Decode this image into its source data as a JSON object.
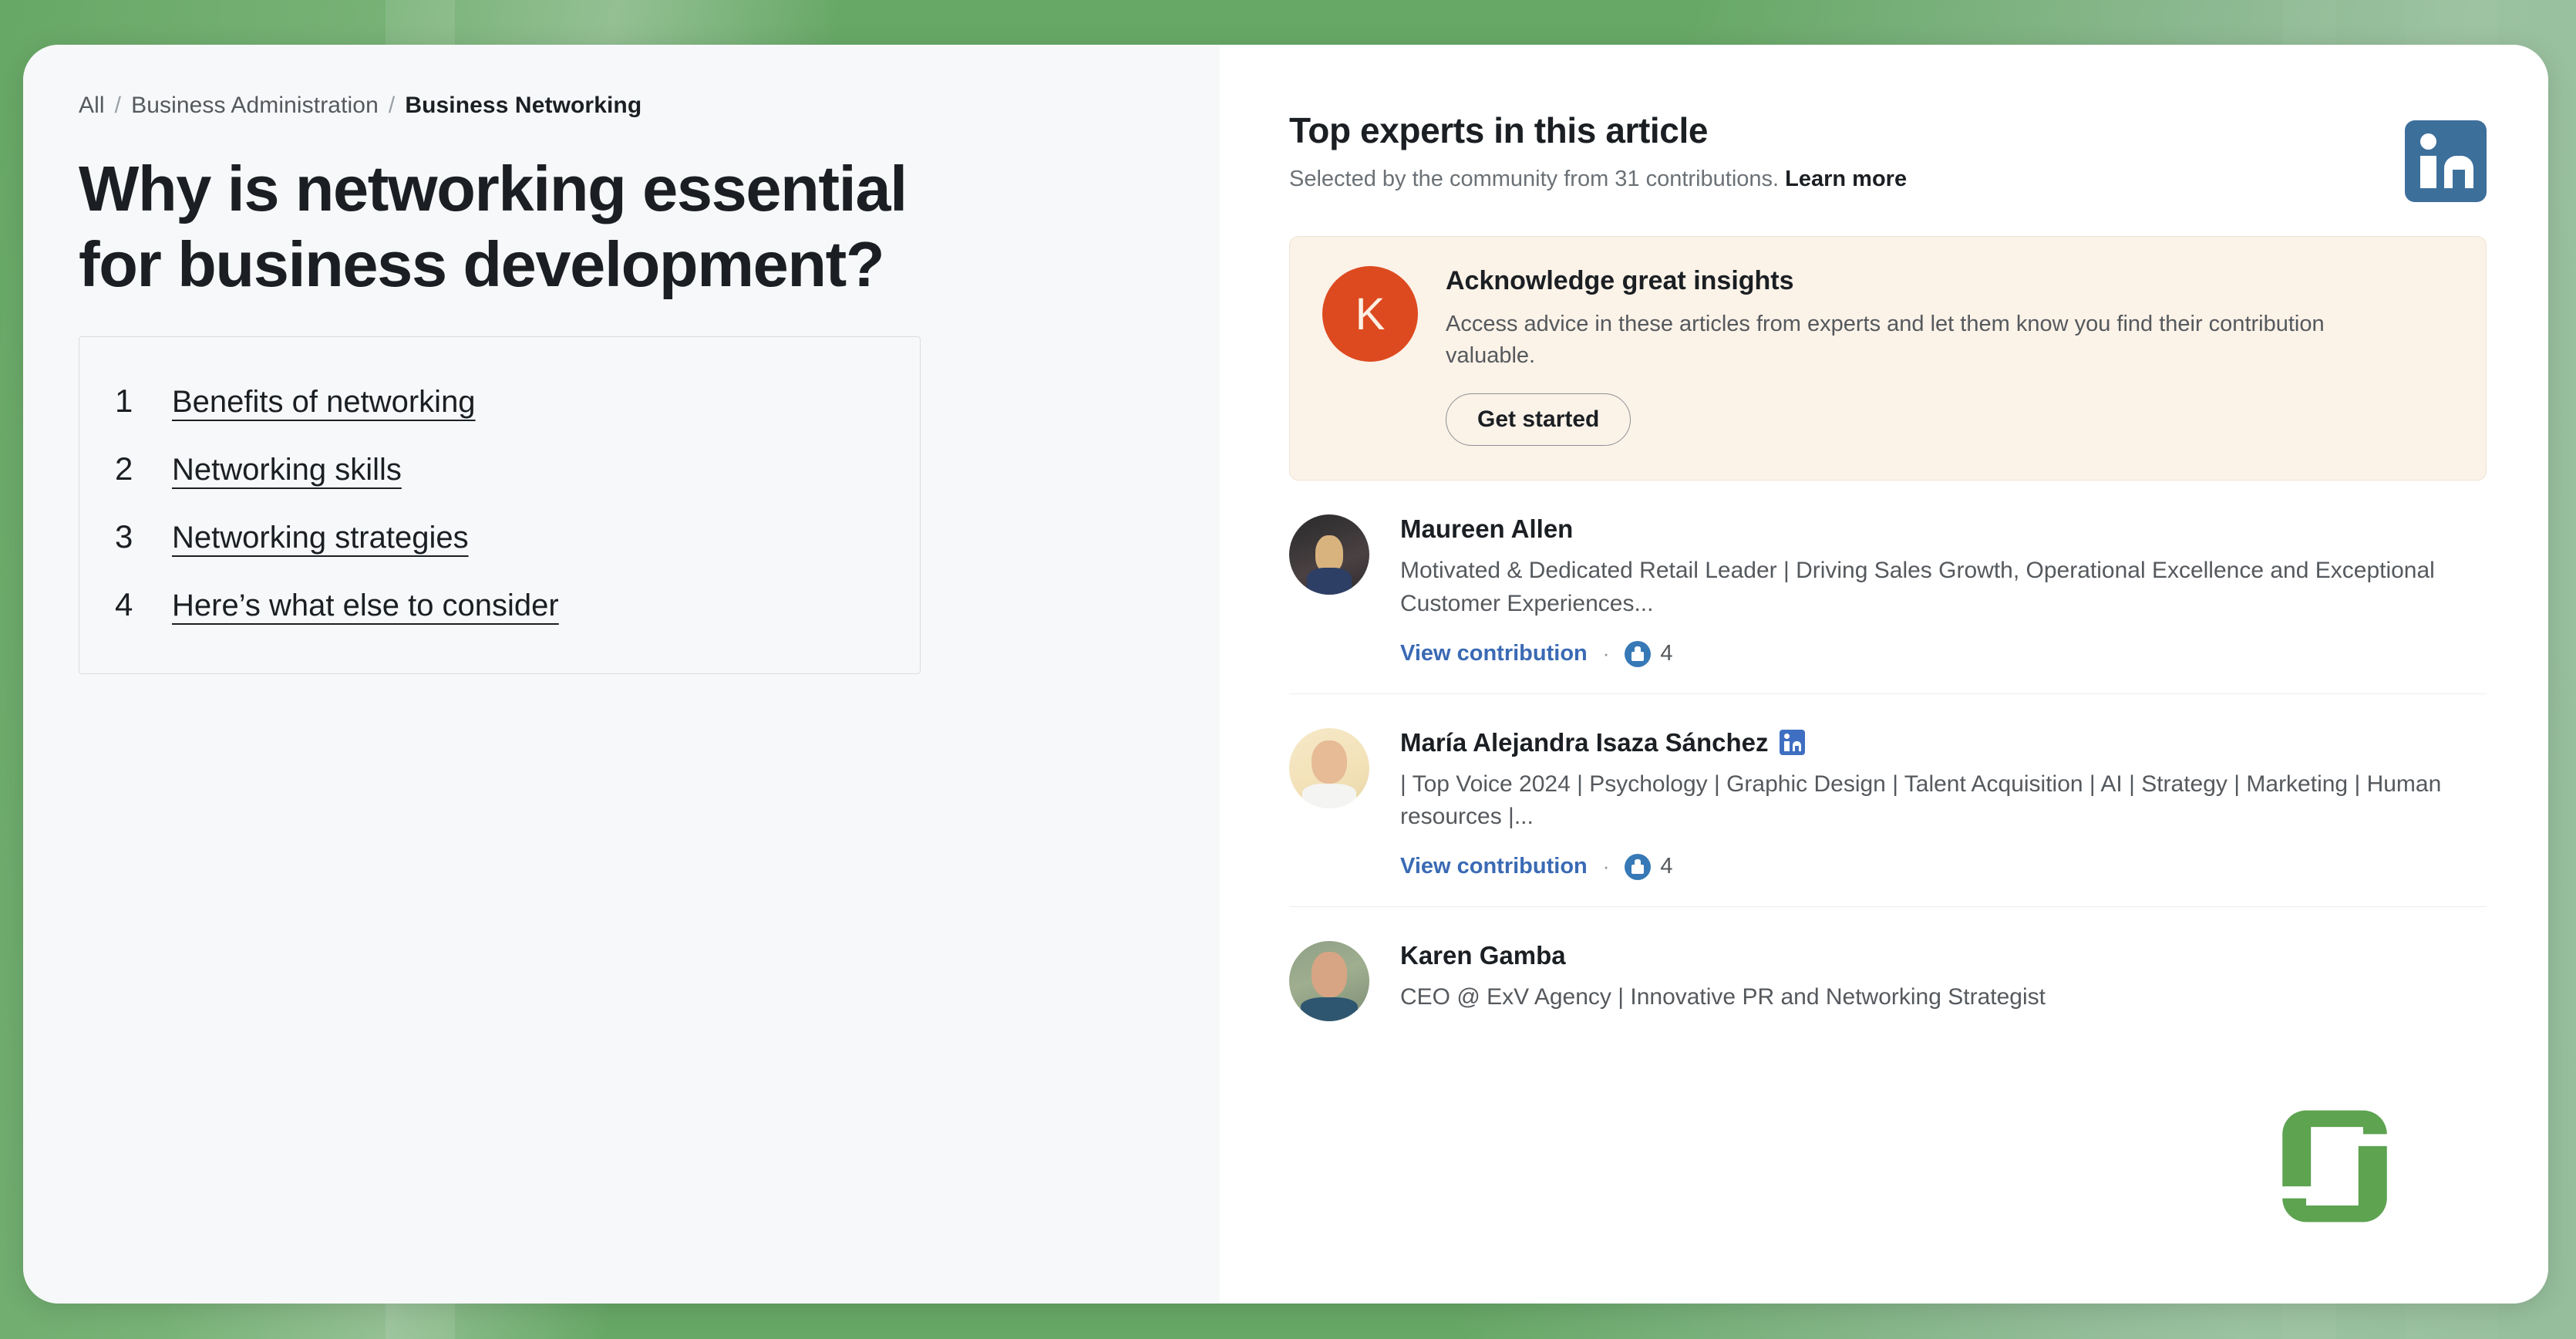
{
  "theme": {
    "background_green": "#67a866",
    "left_panel_bg": "#f7f8f9",
    "right_panel_bg": "#ffffff",
    "promo_bg": "#fbf2e8",
    "promo_avatar_bg": "#dd4a20",
    "link_blue": "#3a6ab4",
    "linkedin_blue": "#3d6f9b",
    "logo_green": "#5da350"
  },
  "breadcrumb": {
    "items": [
      {
        "label": "All",
        "current": false
      },
      {
        "label": "Business Administration",
        "current": false
      },
      {
        "label": "Business Networking",
        "current": true
      }
    ],
    "separator": "/"
  },
  "article": {
    "title": "Why is networking essential for business development?"
  },
  "toc": {
    "items": [
      {
        "number": "1",
        "label": "Benefits of networking"
      },
      {
        "number": "2",
        "label": "Networking skills"
      },
      {
        "number": "3",
        "label": "Networking strategies"
      },
      {
        "number": "4",
        "label": "Here’s what else to consider"
      }
    ]
  },
  "experts_panel": {
    "title": "Top experts in this article",
    "subtitle": "Selected by the community from 31 contributions.",
    "learn_more": "Learn more",
    "linkedin_icon": "linkedin-logo-icon"
  },
  "promo": {
    "avatar_initial": "K",
    "title": "Acknowledge great insights",
    "text": "Access advice in these articles from experts and let them know you find their contribution valuable.",
    "button_label": "Get started"
  },
  "experts": [
    {
      "name": "Maureen Allen",
      "verified_badge": false,
      "headline": "Motivated & Dedicated Retail Leader | Driving Sales Growth, Operational Excellence and Exceptional Customer Experiences...",
      "view_label": "View contribution",
      "separator": "·",
      "reaction_icon": "like-thumbs-up-icon",
      "reaction_count": "4"
    },
    {
      "name": "María Alejandra Isaza Sánchez",
      "verified_badge": true,
      "headline": "| Top Voice 2024 | Psychology | Graphic Design | Talent Acquisition | AI | Strategy | Marketing | Human resources |...",
      "view_label": "View contribution",
      "separator": "·",
      "reaction_icon": "like-thumbs-up-icon",
      "reaction_count": "4"
    },
    {
      "name": "Karen Gamba",
      "verified_badge": false,
      "headline": "CEO @ ExV Agency | Innovative PR and Networking Strategist",
      "view_label": "",
      "separator": "",
      "reaction_icon": "",
      "reaction_count": ""
    }
  ],
  "watermark": {
    "logo_name": "green-g-logo"
  }
}
